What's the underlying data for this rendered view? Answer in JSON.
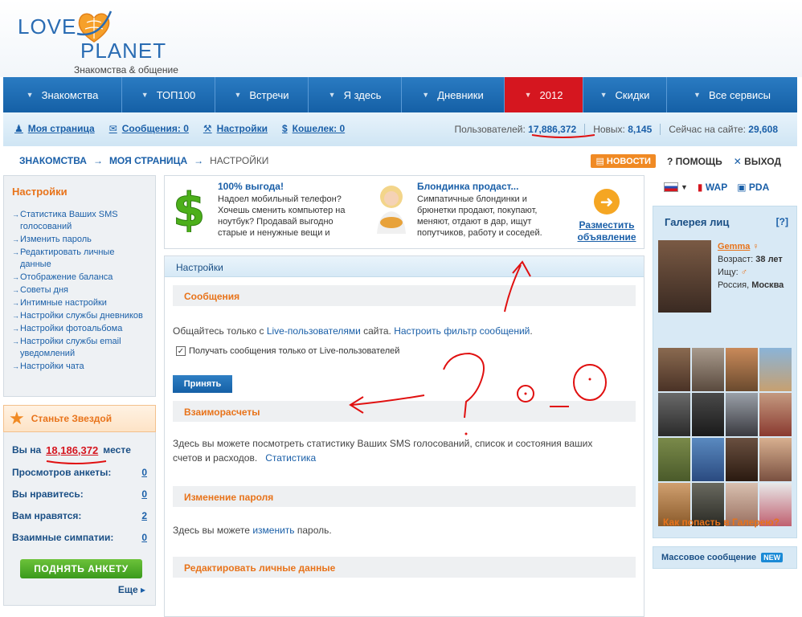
{
  "brand": {
    "love": "LOVE",
    "planet": "PLANET",
    "subtitle": "Знакомства & общение"
  },
  "nav": [
    {
      "label": "Знакомства",
      "active": false
    },
    {
      "label": "ТОП100",
      "active": false
    },
    {
      "label": "Встречи",
      "active": false
    },
    {
      "label": "Я здесь",
      "active": false
    },
    {
      "label": "Дневники",
      "active": false
    },
    {
      "label": "2012",
      "active": true
    },
    {
      "label": "Скидки",
      "active": false
    },
    {
      "label": "Все сервисы",
      "active": false
    }
  ],
  "subbar": {
    "my_page": "Моя страница",
    "messages": "Сообщения: 0",
    "settings": "Настройки",
    "wallet": "Кошелек: 0",
    "users_label": "Пользователей:",
    "users_value": "17,886,372",
    "new_label": "Новых:",
    "new_value": "8,145",
    "online_label": "Сейчас на сайте:",
    "online_value": "29,608"
  },
  "breadcrumb": {
    "a": "ЗНАКОМСТВА",
    "b": "МОЯ СТРАНИЦА",
    "c": "НАСТРОЙКИ"
  },
  "topright": {
    "news": "НОВОСТИ",
    "help": "ПОМОЩЬ",
    "exit": "ВЫХОД"
  },
  "left": {
    "title": "Настройки",
    "items": [
      "Статистика Ваших SMS голосований",
      "Изменить пароль",
      "Редактировать личные данные",
      "Отображение баланса",
      "Советы дня",
      "Интимные настройки",
      "Настройки службы дневников",
      "Настройки фотоальбома",
      "Настройки службы email уведомлений",
      "Настройки чата"
    ],
    "star": "Станьте Звездой",
    "place_pre": "Вы на",
    "place_num": "18,186,372",
    "place_post": "месте",
    "stats": [
      {
        "label": "Просмотров анкеты:",
        "value": "0"
      },
      {
        "label": "Вы нравитесь:",
        "value": "0"
      },
      {
        "label": "Вам нравятся:",
        "value": "2"
      },
      {
        "label": "Взаимные симпатии:",
        "value": "0"
      }
    ],
    "raise_btn": "ПОДНЯТЬ АНКЕТУ",
    "more": "Еще"
  },
  "ads": {
    "ad1_title": "100% выгода!",
    "ad1_text": "Надоел мобильный телефон? Хочешь сменить компьютер на ноутбук? Продавай выгодно старые и ненужные вещи и покупай дешево новые!",
    "ad2_title": "Блондинка продаст...",
    "ad2_text": "Симпатичные блондинки и брюнетки продают, покупают, меняют, отдают в дар, ищут попутчиков, работу и соседей. Тебе есть что предложить?",
    "place_ad": "Разместить объявление"
  },
  "panel": {
    "tab": "Настройки",
    "s1_title": "Сообщения",
    "s1_text_pre": "Общайтесь только с ",
    "s1_link1": "Live-пользователями",
    "s1_text_mid": " сайта. ",
    "s1_link2": "Настроить фильтр сообщений",
    "s1_text_post": ".",
    "s1_checkbox": "Получать сообщения только от Live-пользователей",
    "accept": "Принять",
    "s2_title": "Взаиморасчеты",
    "s2_text": "Здесь вы можете посмотреть статистику Ваших SMS голосований, список и состояния ваших счетов и расходов.",
    "s2_link": "Статистика",
    "s3_title": "Изменение пароля",
    "s3_pre": "Здесь вы можете ",
    "s3_link": "изменить",
    "s3_post": " пароль.",
    "s4_title": "Редактировать личные данные"
  },
  "right": {
    "wap": "WAP",
    "pda": "PDA",
    "gallery_title": "Галерея лиц",
    "gallery_q": "[?]",
    "name": "Gemma",
    "age_label": "Возраст:",
    "age": "38 лет",
    "seek_label": "Ищу:",
    "country": "Россия,",
    "city": "Москва",
    "gallery_link": "Как попасть в Галерею?",
    "mass": "Массовое сообщение",
    "new_badge": "NEW"
  },
  "colors": {
    "nav_blue": "#1a6db5",
    "accent_red": "#d5161f",
    "orange": "#e8731a"
  }
}
